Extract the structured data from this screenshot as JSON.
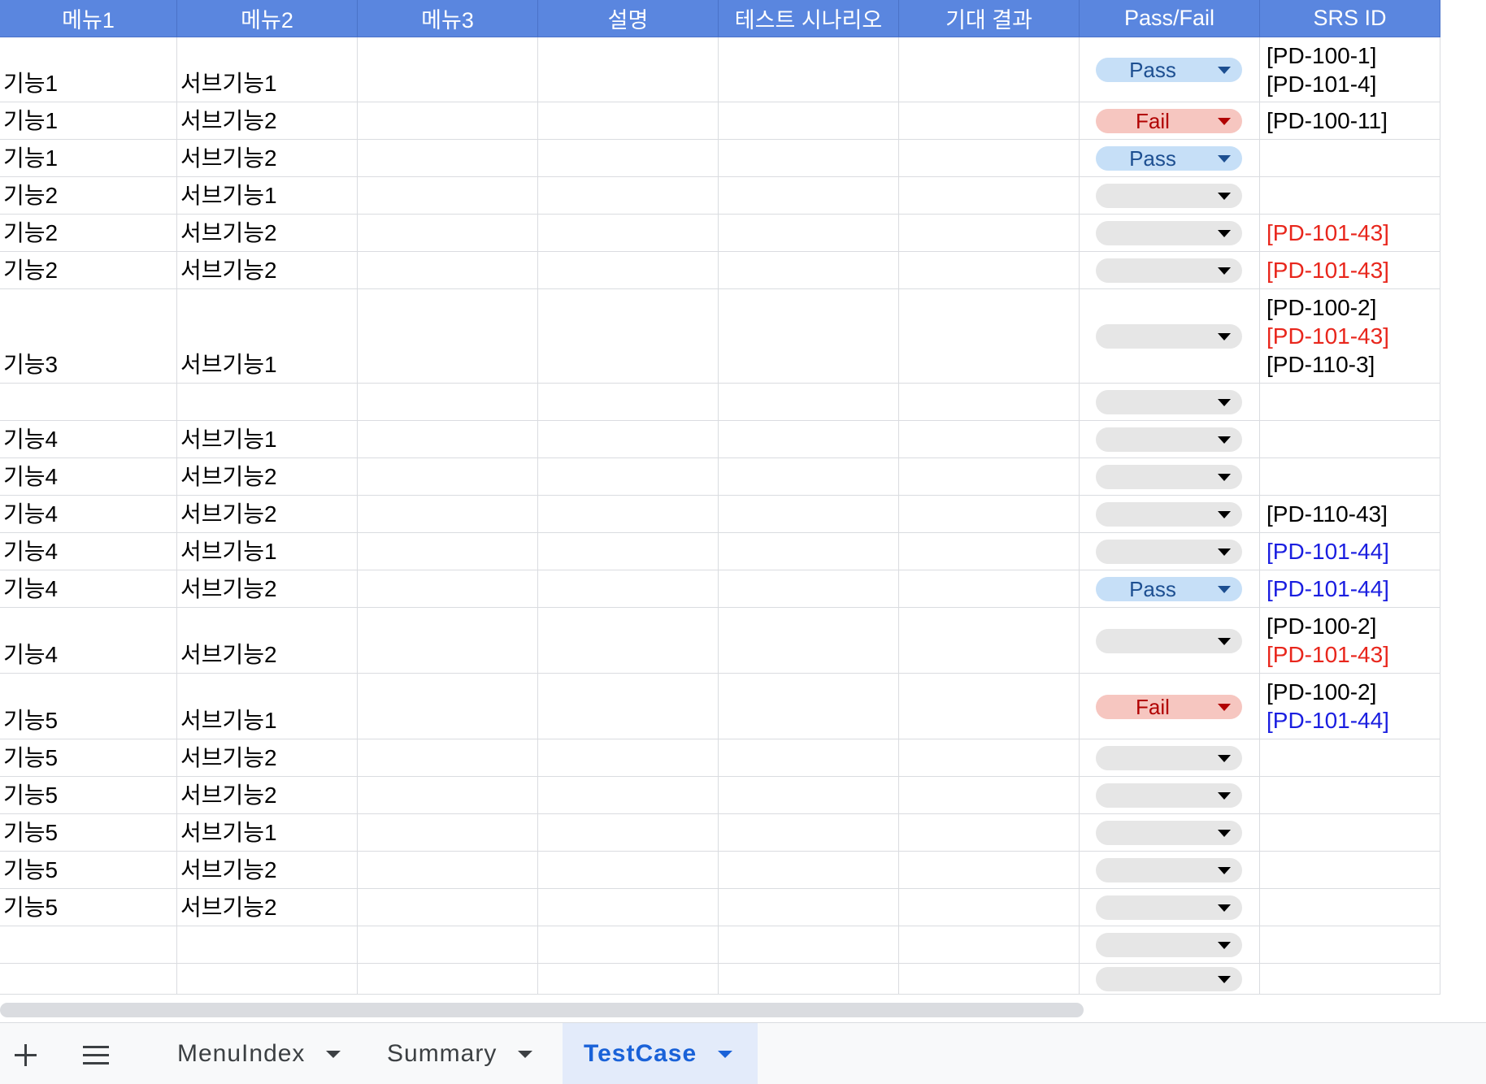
{
  "sheet": {
    "columns": [
      "메뉴1",
      "메뉴2",
      "메뉴3",
      "설명",
      "테스트 시나리오",
      "기대 결과",
      "Pass/Fail",
      "SRS ID"
    ],
    "colors": {
      "header_bg": "#5a86df",
      "header_text": "#ffffff",
      "pass_bg": "#c6dff7",
      "pass_text": "#1d4f91",
      "fail_bg": "#f6c6c0",
      "fail_text": "#b10202",
      "empty_chip_bg": "#e6e6e6",
      "srs_black": "#000000",
      "srs_red": "#e8261c",
      "srs_blue": "#1a1ee0"
    },
    "rows": [
      {
        "m1": "기능1",
        "m2": "서브기능1",
        "status": "Pass",
        "srs": [
          {
            "text": "[PD-100-1]",
            "color": "black"
          },
          {
            "text": "[PD-101-4]",
            "color": "black"
          }
        ]
      },
      {
        "m1": "기능1",
        "m2": "서브기능2",
        "status": "Fail",
        "srs": [
          {
            "text": "[PD-100-11]",
            "color": "black"
          }
        ]
      },
      {
        "m1": "기능1",
        "m2": "서브기능2",
        "status": "Pass",
        "srs": []
      },
      {
        "m1": "기능2",
        "m2": "서브기능1",
        "status": "",
        "srs": []
      },
      {
        "m1": "기능2",
        "m2": "서브기능2",
        "status": "",
        "srs": [
          {
            "text": "[PD-101-43]",
            "color": "red"
          }
        ]
      },
      {
        "m1": "기능2",
        "m2": "서브기능2",
        "status": "",
        "srs": [
          {
            "text": "[PD-101-43]",
            "color": "red"
          }
        ]
      },
      {
        "m1": "기능3",
        "m2": "서브기능1",
        "status": "",
        "srs": [
          {
            "text": "[PD-100-2]",
            "color": "black"
          },
          {
            "text": "[PD-101-43]",
            "color": "red"
          },
          {
            "text": "[PD-110-3]",
            "color": "black"
          }
        ]
      },
      {
        "m1": "",
        "m2": "",
        "status": "",
        "srs": []
      },
      {
        "m1": "기능4",
        "m2": "서브기능1",
        "status": "",
        "srs": []
      },
      {
        "m1": "기능4",
        "m2": "서브기능2",
        "status": "",
        "srs": []
      },
      {
        "m1": "기능4",
        "m2": "서브기능2",
        "status": "",
        "srs": [
          {
            "text": "[PD-110-43]",
            "color": "black"
          }
        ]
      },
      {
        "m1": "기능4",
        "m2": "서브기능1",
        "status": "",
        "srs": [
          {
            "text": "[PD-101-44]",
            "color": "blue"
          }
        ]
      },
      {
        "m1": "기능4",
        "m2": "서브기능2",
        "status": "Pass",
        "srs": [
          {
            "text": "[PD-101-44]",
            "color": "blue"
          }
        ]
      },
      {
        "m1": "기능4",
        "m2": "서브기능2",
        "status": "",
        "srs": [
          {
            "text": "[PD-100-2]",
            "color": "black"
          },
          {
            "text": "[PD-101-43]",
            "color": "red"
          }
        ]
      },
      {
        "m1": "기능5",
        "m2": "서브기능1",
        "status": "Fail",
        "srs": [
          {
            "text": "[PD-100-2]",
            "color": "black"
          },
          {
            "text": "[PD-101-44]",
            "color": "blue"
          }
        ]
      },
      {
        "m1": "기능5",
        "m2": "서브기능2",
        "status": "",
        "srs": []
      },
      {
        "m1": "기능5",
        "m2": "서브기능2",
        "status": "",
        "srs": []
      },
      {
        "m1": "기능5",
        "m2": "서브기능1",
        "status": "",
        "srs": []
      },
      {
        "m1": "기능5",
        "m2": "서브기능2",
        "status": "",
        "srs": []
      },
      {
        "m1": "기능5",
        "m2": "서브기능2",
        "status": "",
        "srs": []
      },
      {
        "m1": "",
        "m2": "",
        "status": "",
        "srs": []
      },
      {
        "m1": "",
        "m2": "",
        "status": "",
        "srs": []
      }
    ]
  },
  "tabbar": {
    "add_icon": "plus-icon",
    "list_icon": "hamburger-menu-icon",
    "tabs": [
      {
        "label": "MenuIndex",
        "active": false
      },
      {
        "label": "Summary",
        "active": false
      },
      {
        "label": "TestCase",
        "active": true
      }
    ]
  }
}
